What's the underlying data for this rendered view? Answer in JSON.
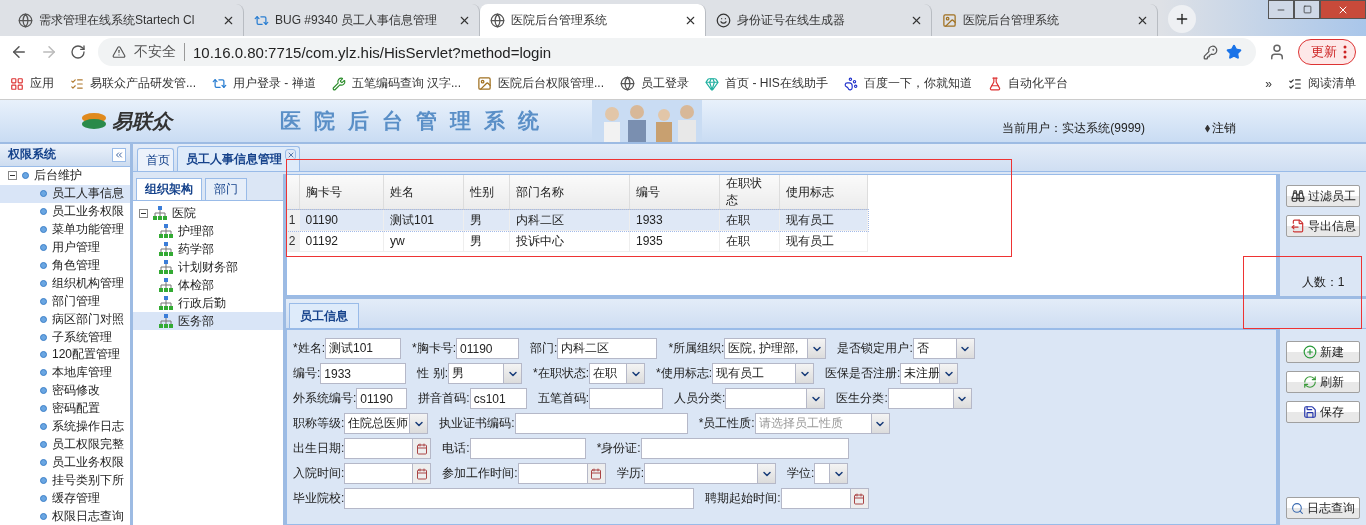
{
  "browser": {
    "tabs": [
      {
        "title": "需求管理在线系统Startech Cl",
        "selected": false
      },
      {
        "title": "BUG #9340 员工人事信息管理",
        "selected": false
      },
      {
        "title": "医院后台管理系统",
        "selected": true
      },
      {
        "title": "身份证号在线生成器",
        "selected": false
      },
      {
        "title": "医院后台管理系统",
        "selected": false
      }
    ],
    "security": "不安全",
    "url": "10.16.0.80:7715/com.ylz.his/HisServlet?method=login",
    "update_button": "更新",
    "bookmarks": [
      "应用",
      "易联众产品研发管...",
      "用户登录 - 禅道",
      "五笔编码查询 汉字...",
      "医院后台权限管理...",
      "员工登录",
      "首页 - HIS在线助手",
      "百度一下，你就知道",
      "自动化平台"
    ],
    "bookmarks_more": "»",
    "reading_list": "阅读清单"
  },
  "app": {
    "logo": "易联众",
    "title": "医院后台管理系统",
    "current_user": "当前用户：实达系统(9999)",
    "logout": "注销"
  },
  "sidebar": {
    "title": "权限系统",
    "tree": [
      {
        "label": "后台维护",
        "expanded": true,
        "children": [
          {
            "label": "员工人事信息",
            "selected": true
          },
          {
            "label": "员工业务权限",
            "selected": false
          },
          {
            "label": "菜单功能管理",
            "selected": false
          },
          {
            "label": "用户管理",
            "selected": false
          },
          {
            "label": "角色管理",
            "selected": false
          },
          {
            "label": "组织机构管理",
            "selected": false
          },
          {
            "label": "部门管理",
            "selected": false
          },
          {
            "label": "病区部门对照",
            "selected": false
          },
          {
            "label": "子系统管理",
            "selected": false
          },
          {
            "label": "120配置管理",
            "selected": false
          },
          {
            "label": "本地库管理",
            "selected": false
          },
          {
            "label": "密码修改",
            "selected": false
          },
          {
            "label": "密码配置",
            "selected": false
          },
          {
            "label": "系统操作日志",
            "selected": false
          },
          {
            "label": "员工权限完整",
            "selected": false
          },
          {
            "label": "员工业务权限",
            "selected": false
          },
          {
            "label": "挂号类别下所",
            "selected": false
          },
          {
            "label": "缓存管理",
            "selected": false
          },
          {
            "label": "权限日志查询",
            "selected": false
          }
        ]
      }
    ]
  },
  "main_tabs": [
    {
      "label": "首页",
      "selected": false,
      "closable": false
    },
    {
      "label": "员工人事信息管理",
      "selected": true,
      "closable": true
    }
  ],
  "org_panel": {
    "tabs": [
      {
        "label": "组织架构",
        "selected": true
      },
      {
        "label": "部门",
        "selected": false
      }
    ],
    "tree": [
      {
        "label": "医院",
        "expanded": true,
        "children": [
          {
            "label": "护理部",
            "selected": false
          },
          {
            "label": "药学部",
            "selected": false
          },
          {
            "label": "计划财务部",
            "selected": false
          },
          {
            "label": "体检部",
            "selected": false
          },
          {
            "label": "行政后勤",
            "selected": false
          },
          {
            "label": "医务部",
            "selected": true
          }
        ]
      }
    ]
  },
  "table": {
    "columns": [
      "胸卡号",
      "姓名",
      "性别",
      "部门名称",
      "编号",
      "在职状态",
      "使用标志"
    ],
    "rows": [
      {
        "index": "1",
        "selected": true,
        "cells": [
          "01190",
          "测试101",
          "男",
          "内科二区",
          "1933",
          "在职",
          "现有员工"
        ]
      },
      {
        "index": "2",
        "selected": false,
        "cells": [
          "01192",
          "yw",
          "男",
          "投诉中心",
          "1935",
          "在职",
          "现有员工"
        ]
      }
    ]
  },
  "grid_actions": [
    {
      "label": "过滤员工",
      "kind": "filter"
    },
    {
      "label": "导出信息",
      "kind": "export"
    }
  ],
  "headcount": "人数：1",
  "detail_tabs": [
    {
      "label": "员工信息",
      "selected": true
    }
  ],
  "form": {
    "fields": [
      {
        "label": "*姓名:",
        "kind": "text",
        "value": "测试101"
      },
      {
        "label": "*胸卡号:",
        "kind": "text",
        "value": "01190"
      },
      {
        "label": "部门:",
        "kind": "text",
        "value": "内科二区"
      },
      {
        "label": "*所属组织:",
        "kind": "select",
        "value": "医院, 护理部,"
      },
      {
        "label": "是否锁定用户:",
        "kind": "select",
        "value": "否"
      },
      {
        "label": "编号:",
        "kind": "text",
        "value": "1933"
      },
      {
        "label": "性 别:",
        "kind": "select",
        "value": "男"
      },
      {
        "label": "*在职状态:",
        "kind": "select",
        "value": "在职"
      },
      {
        "label": "*使用标志:",
        "kind": "select",
        "value": "现有员工"
      },
      {
        "label": "医保是否注册:",
        "kind": "select",
        "value": "未注册"
      },
      {
        "label": "外系统编号:",
        "kind": "text",
        "value": "01190"
      },
      {
        "label": "拼音首码:",
        "kind": "text",
        "value": "cs101"
      },
      {
        "label": "五笔首码:",
        "kind": "text"
      },
      {
        "label": "人员分类:",
        "kind": "select"
      },
      {
        "label": "医生分类:",
        "kind": "select"
      },
      {
        "label": "职称等级:",
        "kind": "select",
        "value": "住院总医师"
      },
      {
        "label": "执业证书编码:",
        "kind": "text"
      },
      {
        "label": "*员工性质:",
        "kind": "select",
        "placeholder": "请选择员工性质"
      },
      {
        "label": "出生日期:",
        "kind": "date"
      },
      {
        "label": "电话:",
        "kind": "text"
      },
      {
        "label": "*身份证:",
        "kind": "text"
      },
      {
        "label": "入院时间:",
        "kind": "date"
      },
      {
        "label": "参加工作时间:",
        "kind": "date"
      },
      {
        "label": "学历:",
        "kind": "select"
      },
      {
        "label": "学位:",
        "kind": "select"
      },
      {
        "label": "毕业院校:",
        "kind": "text"
      },
      {
        "label": "聘期起始时间:",
        "kind": "date"
      }
    ]
  },
  "form_actions": [
    {
      "label": "新建",
      "kind": "new"
    },
    {
      "label": "刷新",
      "kind": "refresh"
    },
    {
      "label": "保存",
      "kind": "save"
    }
  ],
  "log_button": "日志查询"
}
